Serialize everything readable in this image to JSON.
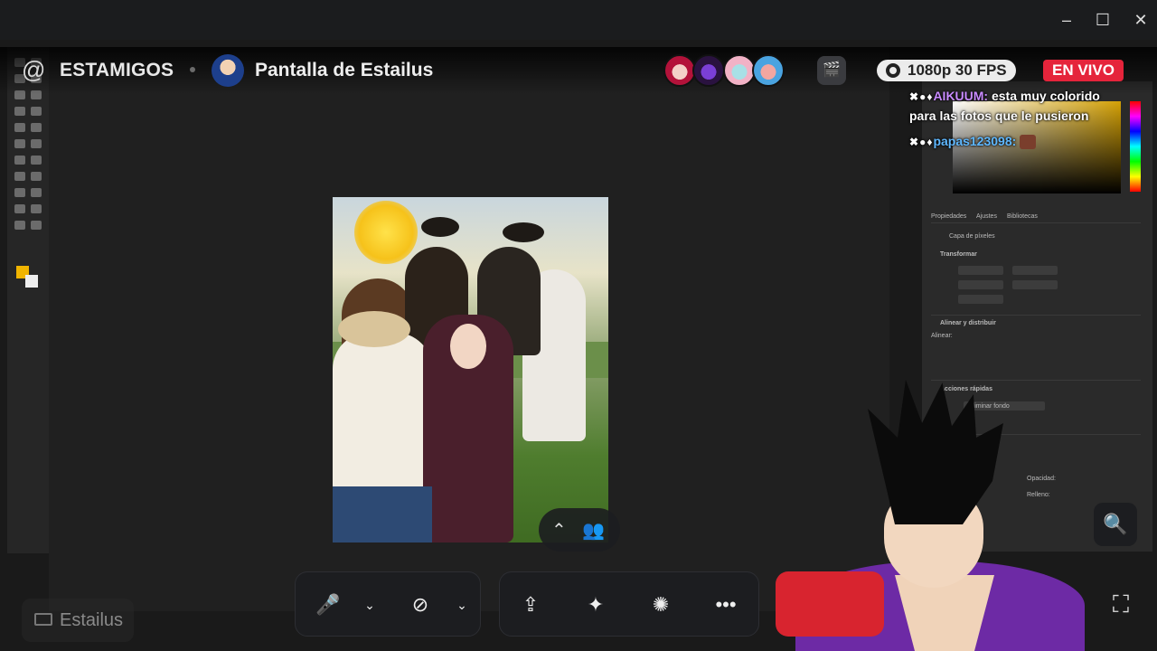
{
  "window": {
    "minimize_icon": "minimize-icon",
    "maximize_icon": "maximize-icon",
    "close_icon": "close-icon"
  },
  "header": {
    "channel_icon": "at-icon",
    "server_name": "ESTAMIGOS",
    "screen_title": "Pantalla de Estailus",
    "activity_icon": "clapperboard-icon",
    "quality": "1080p 30 FPS",
    "live_badge": "EN VIVO",
    "colors": {
      "live": "#e5243b"
    }
  },
  "chat": {
    "messages": [
      {
        "user": "AIKUUM:",
        "text": "esta muy colorido para las fotos que le pusieron"
      },
      {
        "user": "papas123098:",
        "text": ""
      }
    ]
  },
  "photoshop": {
    "tabs": [
      "Propiedades",
      "Ajustes",
      "Bibliotecas"
    ],
    "layer_type": "Capa de píxeles",
    "sections": [
      "Transformar",
      "Alinear y distribuir",
      "Alinear:",
      "Acciones rápidas"
    ],
    "quick_action": "Eliminar fondo",
    "opacity_label": "Opacidad:",
    "fill_label": "Relleno:"
  },
  "controls": {
    "mic_icon": "microphone-icon",
    "camera_icon": "camera-off-icon",
    "share_icon": "screen-share-icon",
    "activities_icon": "activities-icon",
    "soundboard_icon": "soundboard-icon",
    "more_icon": "more-icon",
    "chevron_icon": "chevron-down-icon",
    "expand_icon": "fullscreen-icon",
    "zoom_icon": "zoom-in-icon"
  },
  "self": {
    "name": "Estailus"
  }
}
